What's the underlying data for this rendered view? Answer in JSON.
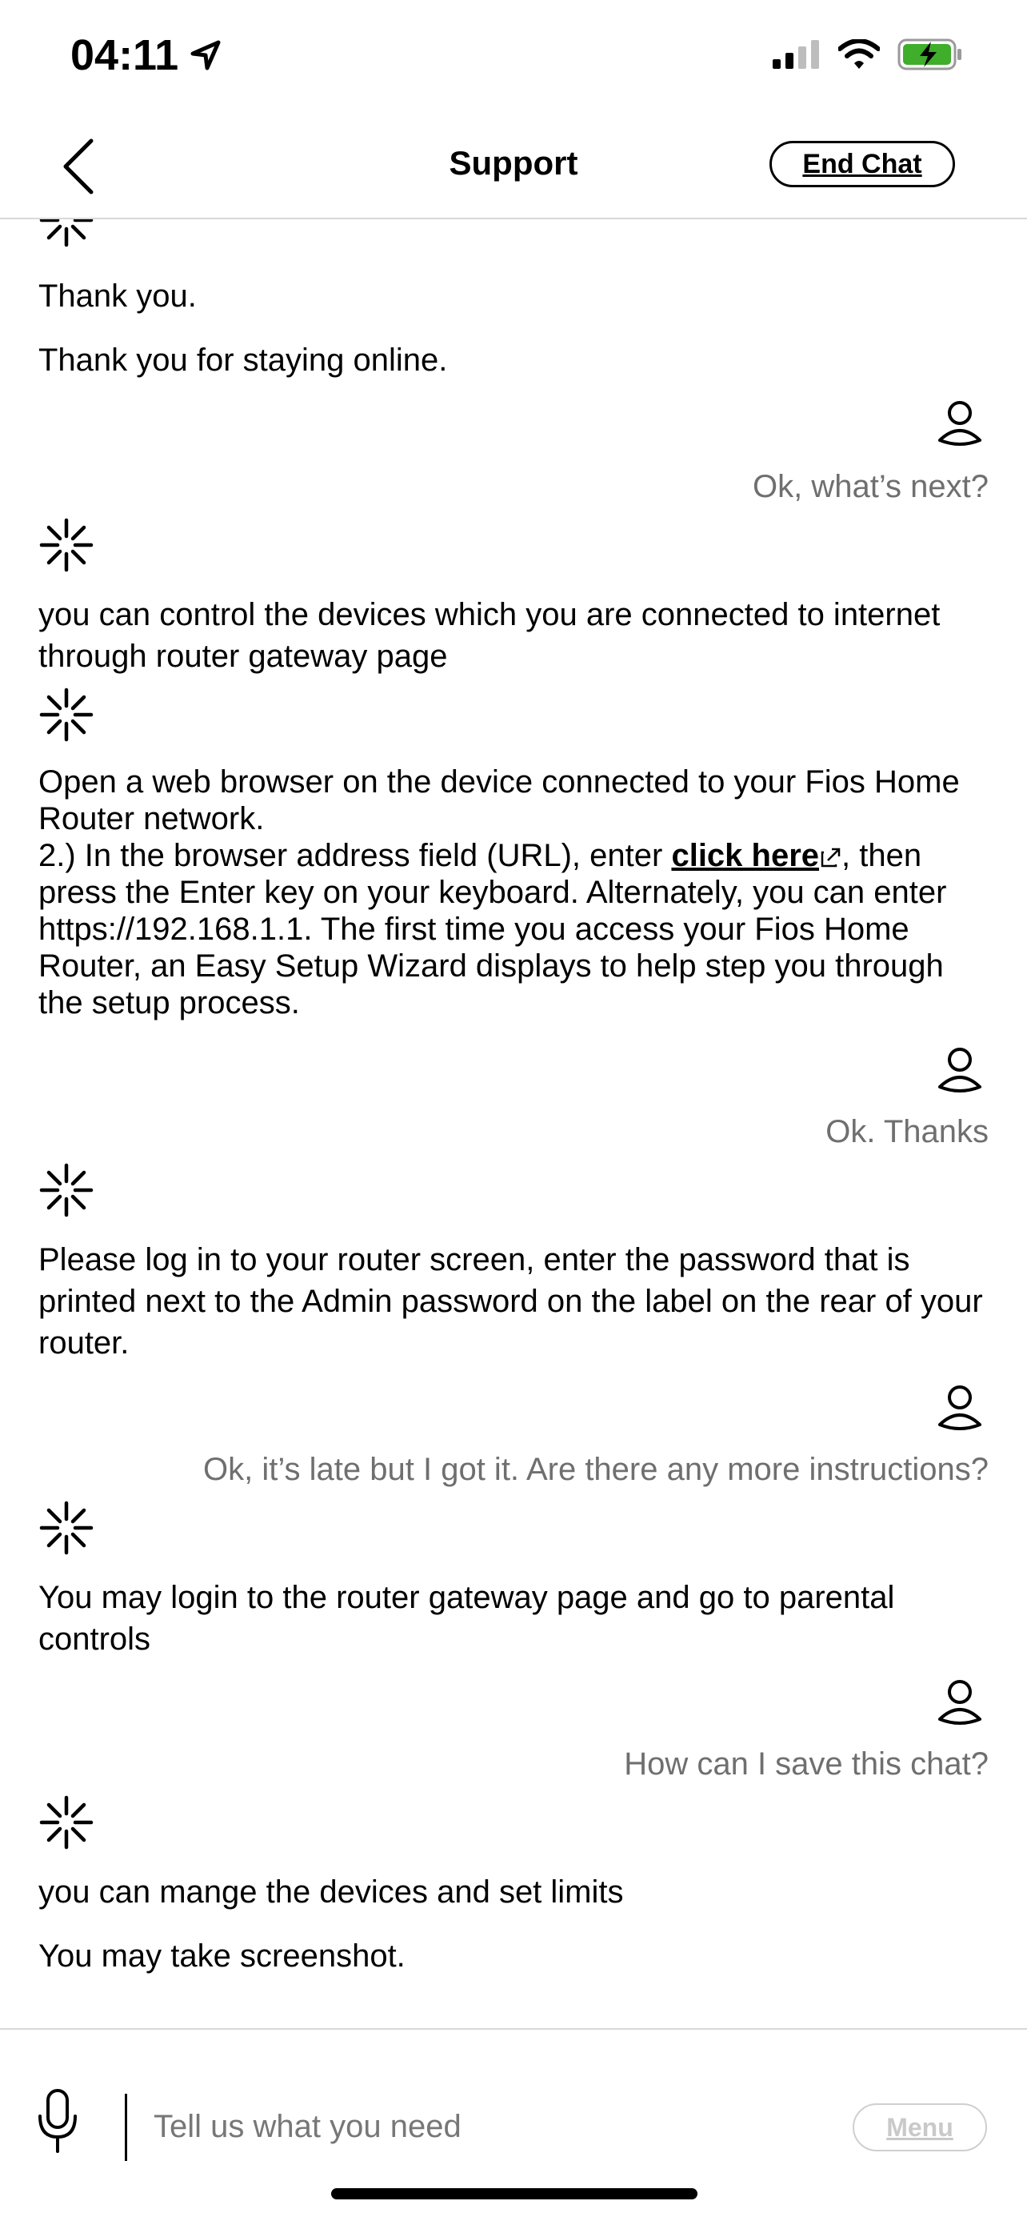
{
  "status_bar": {
    "time": "04:11",
    "icons": [
      "location-arrow-icon",
      "cellular-signal-icon",
      "wifi-icon",
      "battery-charging-icon"
    ],
    "battery_color": "#3fae2a"
  },
  "header": {
    "title": "Support",
    "end_chat_label": "End Chat",
    "back_icon": "chevron-left-icon"
  },
  "messages": {
    "m1": "Thank you.",
    "m2": "Thank you for staying online.",
    "u1": "Ok, what’s next?",
    "m3": "you can control the devices which you are connected to internet through router gateway page",
    "m4_part1": "Open a web browser on the device connected to your Fios Home Router network.",
    "m4_part2_prefix": "2.) In the browser address field (URL), enter ",
    "m4_link": "click here",
    "m4_part2_suffix": ", then press the Enter key on your keyboard. Alternately, you can enter https://192.168.1.1. The first time you access your Fios Home Router, an Easy Setup Wizard displays to help step you through the setup process.",
    "u2": "Ok. Thanks",
    "m5": "Please log in to your router screen, enter the password that is printed next to the Admin password on the label on the rear of your router.",
    "u3": "Ok, it’s late but I got it. Are there any more instructions?",
    "m6": "You may login to the router gateway page and go to parental controls",
    "u4": "How can I save this chat?",
    "m7": "you can mange the devices  and set limits",
    "m8": "You may take screenshot."
  },
  "input_bar": {
    "placeholder": "Tell us what you need",
    "value": "",
    "menu_label": "Menu",
    "mic_icon": "microphone-icon"
  }
}
